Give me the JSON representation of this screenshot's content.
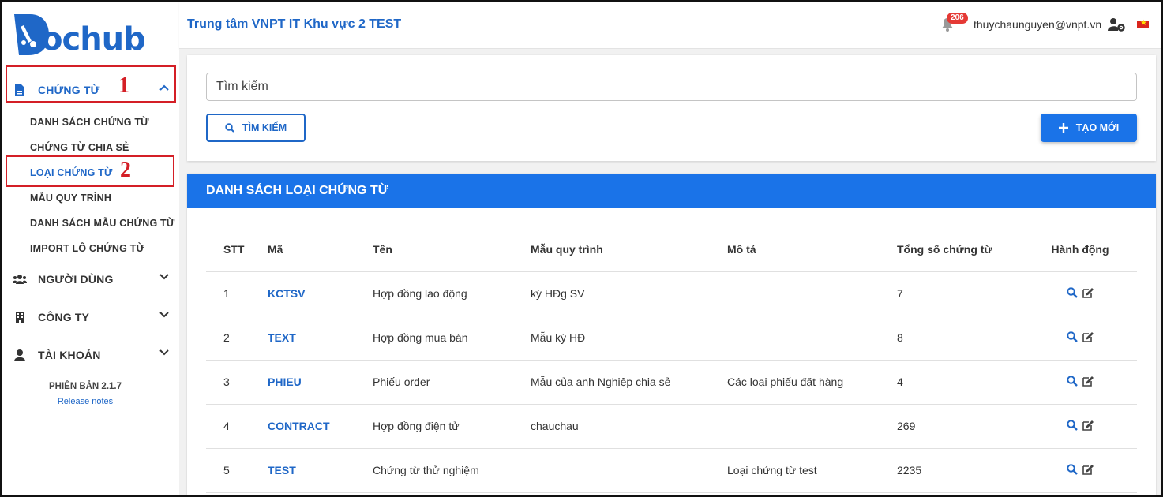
{
  "sidebar": {
    "logo_text": "ochub",
    "groups": [
      {
        "label": "CHỨNG TỪ",
        "icon": "document-icon"
      },
      {
        "label": "NGƯỜI DÙNG",
        "icon": "users-icon"
      },
      {
        "label": "CÔNG TY",
        "icon": "building-icon"
      },
      {
        "label": "TÀI KHOẢN",
        "icon": "user-icon"
      }
    ],
    "sub_items": [
      {
        "label": "DANH SÁCH CHỨNG TỪ"
      },
      {
        "label": "CHỨNG TỪ CHIA SẺ"
      },
      {
        "label": "LOẠI CHỨNG TỪ"
      },
      {
        "label": "MẪU QUY TRÌNH"
      },
      {
        "label": "DANH SÁCH MẪU CHỨNG TỪ"
      },
      {
        "label": "IMPORT LÔ CHỨNG TỪ"
      }
    ],
    "version": "PHIÊN BẢN 2.1.7",
    "release_notes": "Release notes",
    "annotations": [
      "1",
      "2"
    ]
  },
  "header": {
    "org_title": "Trung tâm VNPT IT Khu vực 2 TEST",
    "notification_count": "206",
    "user_email": "thuychaunguyen@vnpt.vn"
  },
  "search": {
    "placeholder": "Tìm kiếm",
    "search_button": "TÌM KIẾM",
    "create_button": "TẠO MỚI"
  },
  "list": {
    "title": "DANH SÁCH LOẠI CHỨNG TỪ",
    "columns": [
      "STT",
      "Mã",
      "Tên",
      "Mẫu quy trình",
      "Mô tả",
      "Tổng số chứng từ",
      "Hành động"
    ],
    "rows": [
      {
        "stt": "1",
        "code": "KCTSV",
        "name": "Hợp đồng lao động",
        "template": "ký HĐg SV",
        "desc": "",
        "total": "7"
      },
      {
        "stt": "2",
        "code": "TEXT",
        "name": "Hợp đồng mua bán",
        "template": "Mẫu ký HĐ",
        "desc": "",
        "total": "8"
      },
      {
        "stt": "3",
        "code": "PHIEU",
        "name": "Phiếu order",
        "template": "Mẫu của anh Nghiệp chia sẻ",
        "desc": "Các loại phiếu đặt hàng",
        "total": "4"
      },
      {
        "stt": "4",
        "code": "CONTRACT",
        "name": "Hợp đồng điện tử",
        "template": "chauchau",
        "desc": "",
        "total": "269"
      },
      {
        "stt": "5",
        "code": "TEST",
        "name": "Chứng từ thử nghiệm",
        "template": "",
        "desc": "Loại chứng từ test",
        "total": "2235"
      }
    ]
  },
  "colors": {
    "primary": "#1a73e8",
    "link": "#1f67c7",
    "annotation": "#d41f26",
    "badge": "#e53935"
  }
}
